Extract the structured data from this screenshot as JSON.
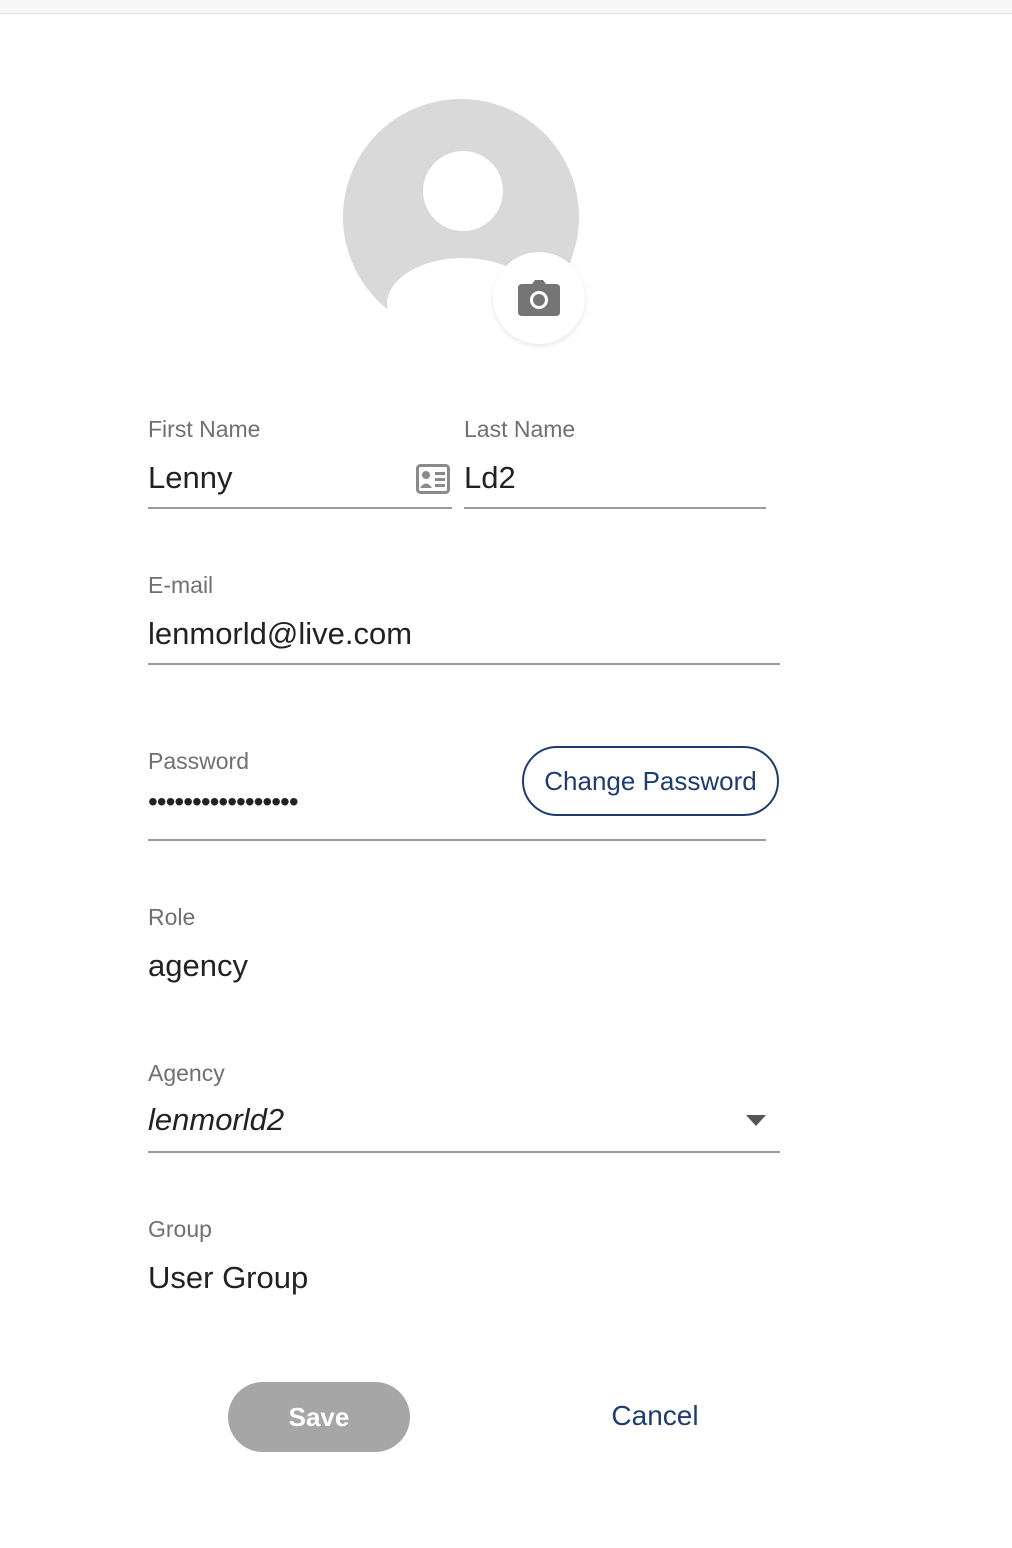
{
  "profile": {
    "avatar_icon": "user-placeholder-icon",
    "camera_icon": "camera-icon"
  },
  "form": {
    "first_name": {
      "label": "First Name",
      "value": "Lenny",
      "icon": "contact-card-icon"
    },
    "last_name": {
      "label": "Last Name",
      "value": "Ld2"
    },
    "email": {
      "label": "E-mail",
      "value": "lenmorld@live.com"
    },
    "password": {
      "label": "Password",
      "value": "•••••••••••••••••",
      "change_label": "Change Password"
    },
    "role": {
      "label": "Role",
      "value": "agency"
    },
    "agency": {
      "label": "Agency",
      "value": "lenmorld2"
    },
    "group": {
      "label": "Group",
      "value": "User Group"
    }
  },
  "actions": {
    "save_label": "Save",
    "cancel_label": "Cancel"
  },
  "colors": {
    "accent": "#1f3c6e",
    "label": "#707070",
    "underline": "#9b9b9b",
    "avatar": "#d9d9d9",
    "save_disabled": "#a6a6a6"
  }
}
